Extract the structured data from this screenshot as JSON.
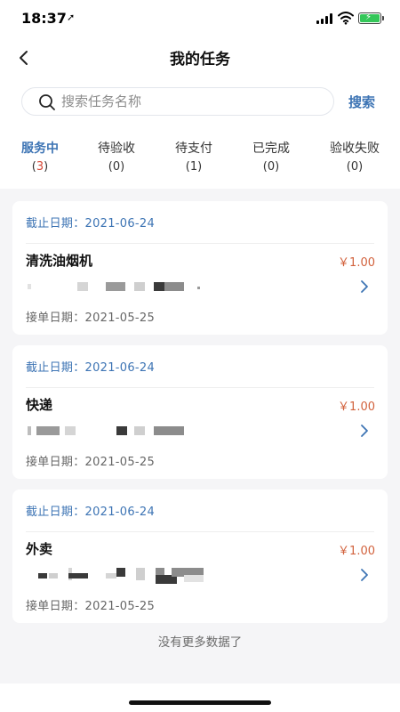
{
  "status": {
    "time": "18:37",
    "location_glyph": "➚"
  },
  "nav": {
    "title": "我的任务"
  },
  "search": {
    "placeholder": "搜索任务名称",
    "button": "搜索"
  },
  "tabs": [
    {
      "label": "服务中",
      "open": "(",
      "count": "3",
      "close": ")"
    },
    {
      "label": "待验收",
      "count": "(0)"
    },
    {
      "label": "待支付",
      "count": "(1)"
    },
    {
      "label": "已完成",
      "count": "(0)"
    },
    {
      "label": "验收失败",
      "count": "(0)"
    }
  ],
  "tasks": [
    {
      "deadline": "截止日期：2021-06-24",
      "title": "清洗油烟机",
      "price": "￥1.00",
      "accept_date": "接单日期：2021-05-25"
    },
    {
      "deadline": "截止日期：2021-06-24",
      "title": "快递",
      "price": "￥1.00",
      "accept_date": "接单日期：2021-05-25"
    },
    {
      "deadline": "截止日期：2021-06-24",
      "title": "外卖",
      "price": "￥1.00",
      "accept_date": "接单日期：2021-05-25"
    }
  ],
  "footer": {
    "no_more": "没有更多数据了"
  },
  "colors": {
    "accent": "#3d74b4",
    "price": "#d2623d",
    "count_active": "#d64a3a",
    "battery": "#34c759"
  },
  "icons": [
    "back-arrow-icon",
    "search-icon",
    "chevron-right-icon",
    "signal-icon",
    "wifi-icon",
    "battery-icon"
  ]
}
